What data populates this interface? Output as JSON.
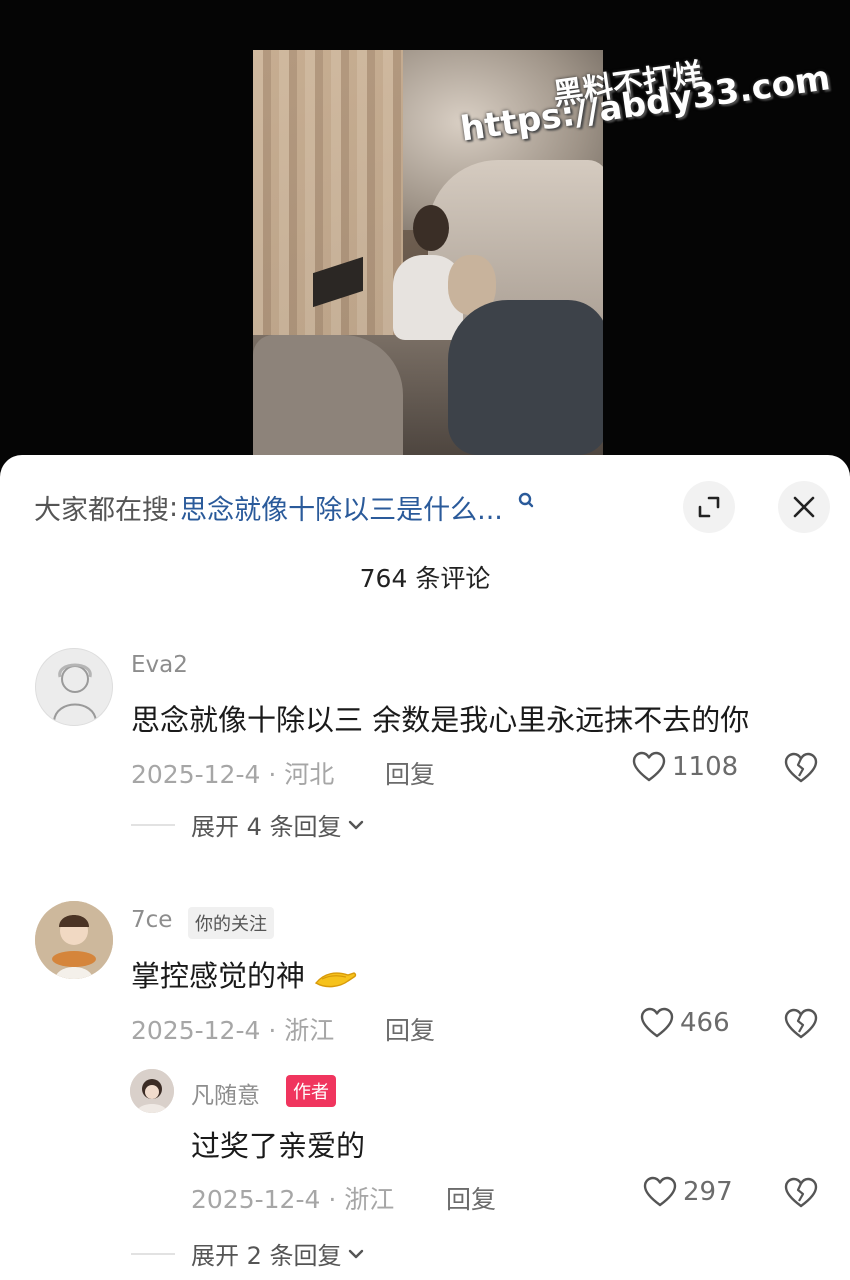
{
  "watermark": {
    "line1": "黑料不打烊",
    "line2": "https://abdy33.com"
  },
  "search": {
    "prefix": "大家都在搜",
    "colon": ":",
    "term": "思念就像十除以三是什么..."
  },
  "comment_count": "764 条评论",
  "comments": [
    {
      "username": "Eva2",
      "text": "思念就像十除以三 余数是我心里永远抹不去的你",
      "meta": "2025-12-4 · 河北",
      "reply_label": "回复",
      "likes": "1108",
      "expand": "展开 4 条回复"
    },
    {
      "username": "7ce",
      "badge": "你的关注",
      "text": "掌控感觉的神",
      "meta": "2025-12-4 · 浙江",
      "reply_label": "回复",
      "likes": "466",
      "reply": {
        "username": "凡随意",
        "badge": "作者",
        "text": "过奖了亲爱的",
        "meta": "2025-12-4 · 浙江",
        "reply_label": "回复",
        "likes": "297"
      },
      "expand": "展开 2 条回复"
    }
  ],
  "colors": {
    "accent_link": "#2a5a9a",
    "author_badge": "#f0355e"
  }
}
